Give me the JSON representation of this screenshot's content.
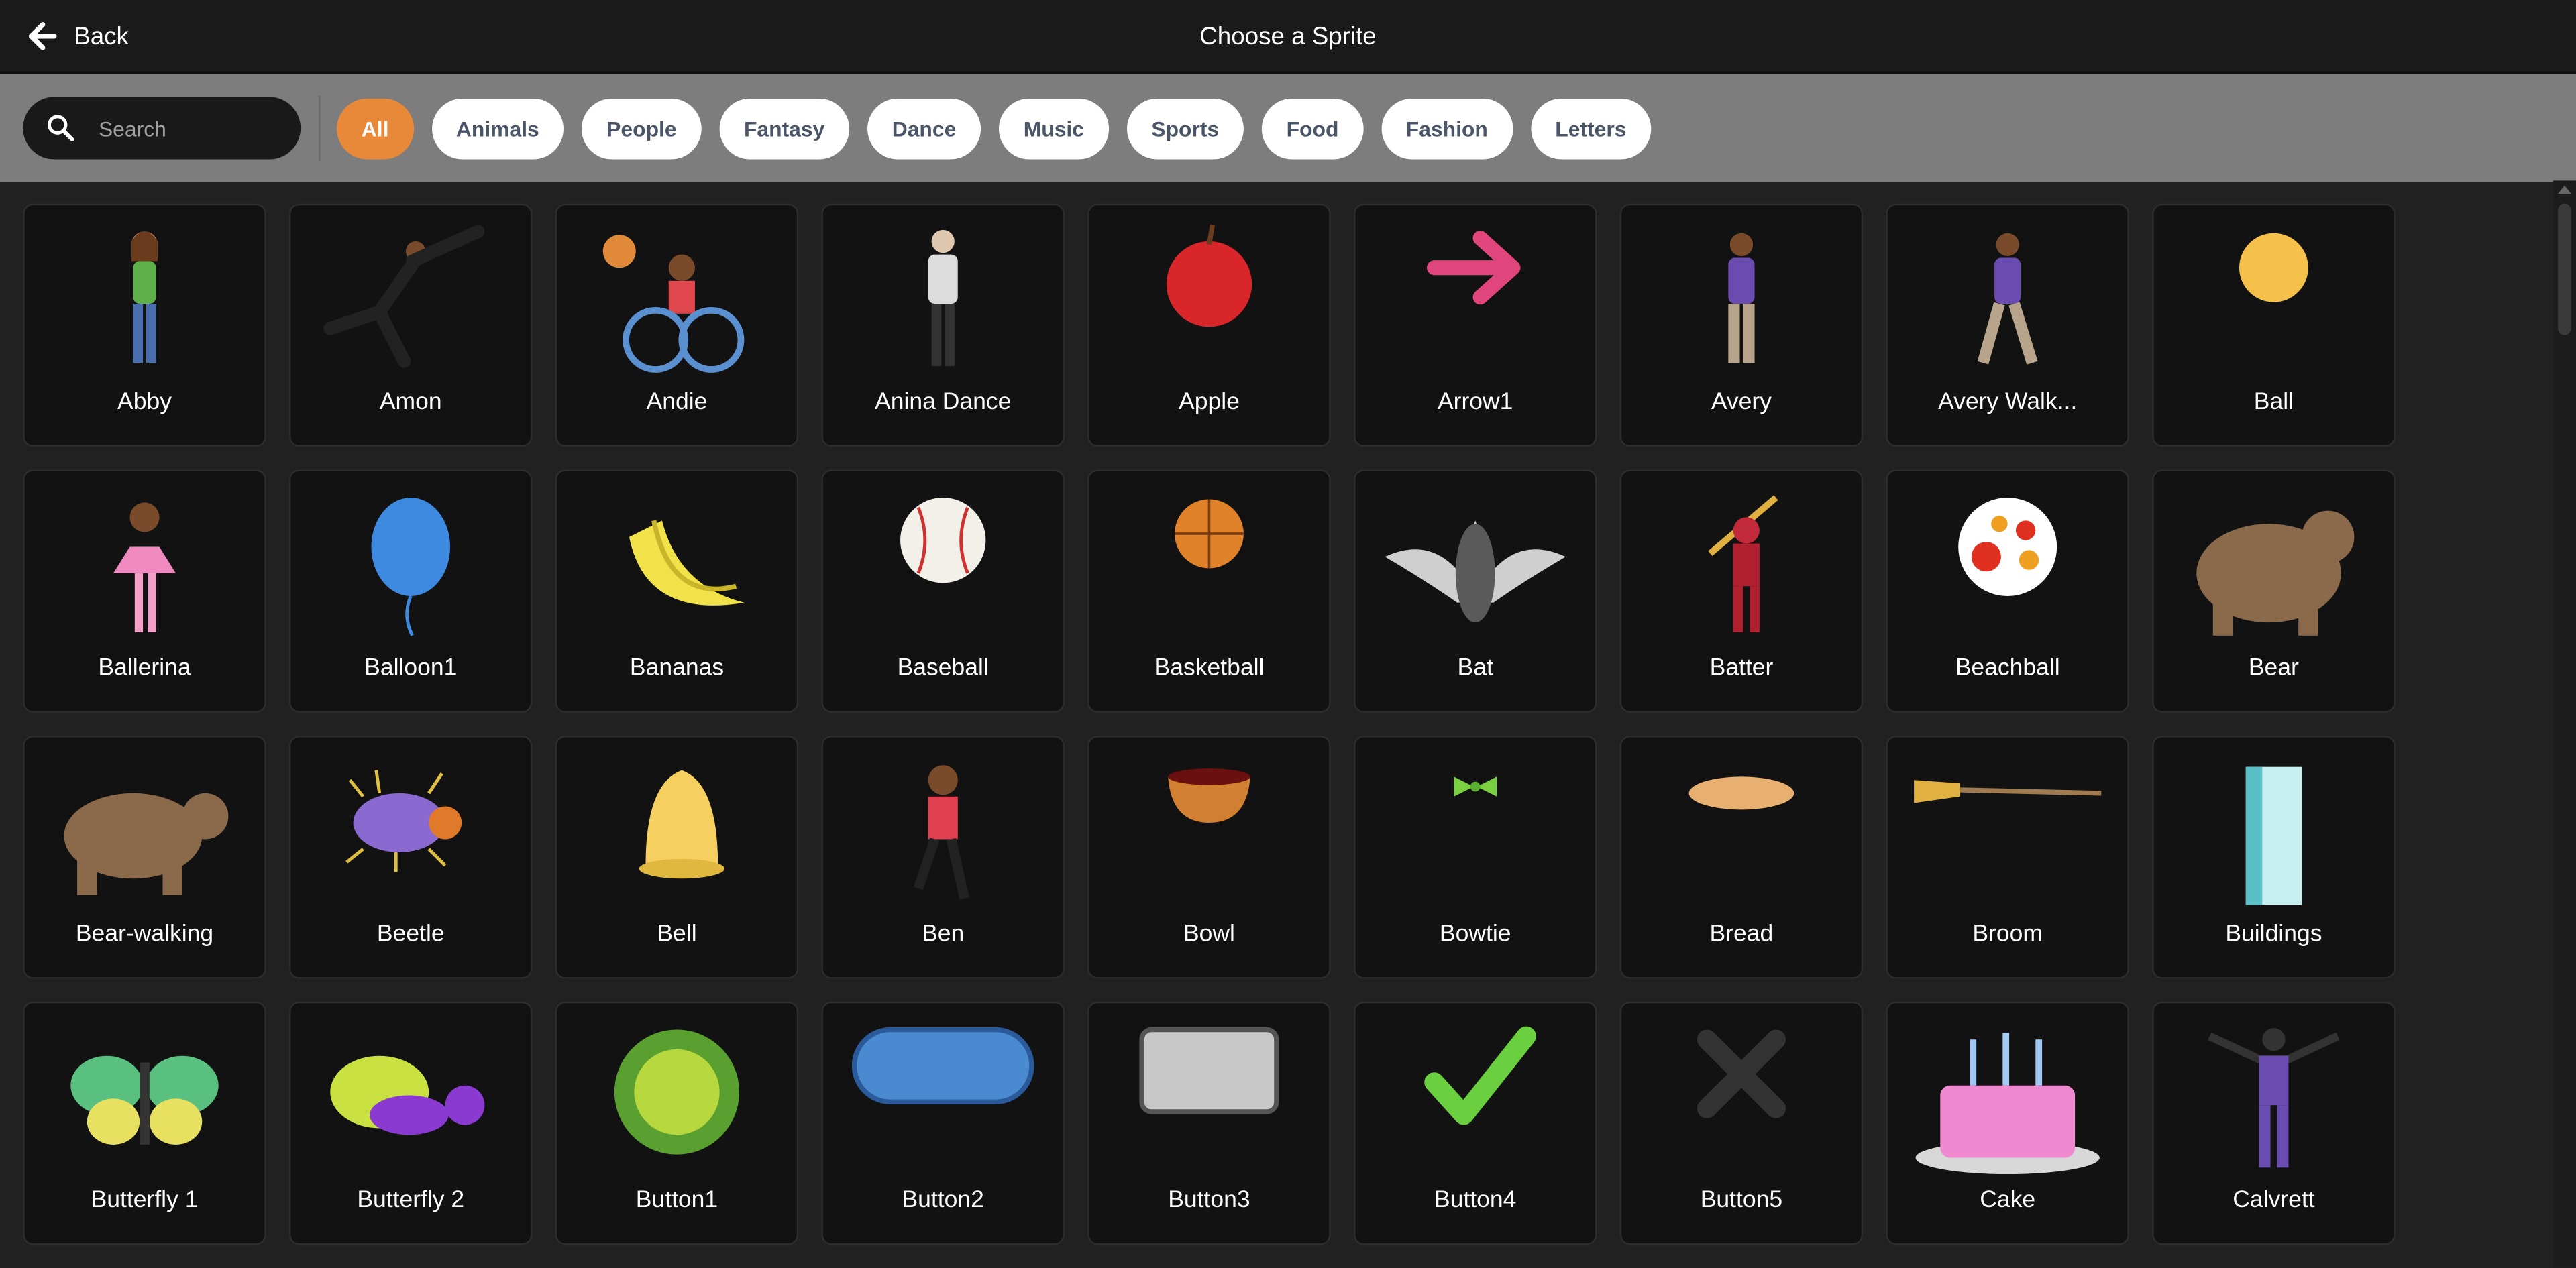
{
  "header": {
    "back_label": "Back",
    "title": "Choose a Sprite"
  },
  "search": {
    "placeholder": "Search"
  },
  "tags": [
    "All",
    "Animals",
    "People",
    "Fantasy",
    "Dance",
    "Music",
    "Sports",
    "Food",
    "Fashion",
    "Letters"
  ],
  "active_tag": "All",
  "colors": {
    "accent": "#e8893a",
    "filter_bar": "#7d7d7d",
    "header": "#1a1a1a",
    "tile": "#121212"
  },
  "sprites": [
    {
      "label": "Abby"
    },
    {
      "label": "Amon"
    },
    {
      "label": "Andie"
    },
    {
      "label": "Anina Dance"
    },
    {
      "label": "Apple"
    },
    {
      "label": "Arrow1"
    },
    {
      "label": "Avery"
    },
    {
      "label": "Avery Walk..."
    },
    {
      "label": "Ball"
    },
    {
      "label": "Ballerina"
    },
    {
      "label": "Balloon1"
    },
    {
      "label": "Bananas"
    },
    {
      "label": "Baseball"
    },
    {
      "label": "Basketball"
    },
    {
      "label": "Bat"
    },
    {
      "label": "Batter"
    },
    {
      "label": "Beachball"
    },
    {
      "label": "Bear"
    },
    {
      "label": "Bear-walking"
    },
    {
      "label": "Beetle"
    },
    {
      "label": "Bell"
    },
    {
      "label": "Ben"
    },
    {
      "label": "Bowl"
    },
    {
      "label": "Bowtie"
    },
    {
      "label": "Bread"
    },
    {
      "label": "Broom"
    },
    {
      "label": "Buildings"
    },
    {
      "label": "Butterfly 1"
    },
    {
      "label": "Butterfly 2"
    },
    {
      "label": "Button1"
    },
    {
      "label": "Button2"
    },
    {
      "label": "Button3"
    },
    {
      "label": "Button4"
    },
    {
      "label": "Button5"
    },
    {
      "label": "Cake"
    },
    {
      "label": "Calvrett"
    }
  ]
}
